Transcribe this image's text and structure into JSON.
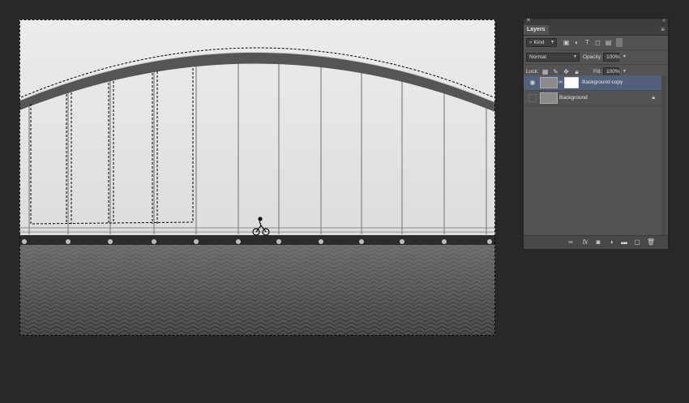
{
  "panel": {
    "tab_label": "Layers",
    "filter": {
      "kind_label": "Kind"
    },
    "blend_mode": "Normal",
    "opacity_label": "Opacity:",
    "opacity_value": "100%",
    "lock_label": "Lock:",
    "fill_label": "Fill:",
    "fill_value": "100%",
    "layers": [
      {
        "name": "Background copy",
        "visible": true,
        "selected": true,
        "has_mask": true
      },
      {
        "name": "Background",
        "visible": false,
        "selected": false,
        "locked": true
      }
    ]
  },
  "colors": {
    "app_bg": "#282828",
    "panel_bg": "#535353",
    "selection": "#52617a"
  },
  "icons": {
    "filter": [
      "pixel-filter-icon",
      "adjustment-filter-icon",
      "type-filter-icon",
      "shape-filter-icon",
      "smart-object-filter-icon",
      "filter-toggle-icon"
    ],
    "lock": [
      "lock-transparent-icon",
      "lock-image-icon",
      "lock-position-icon",
      "lock-all-icon"
    ],
    "footer": [
      "link-layers-icon",
      "fx-icon",
      "add-mask-icon",
      "adjustment-layer-icon",
      "new-group-icon",
      "new-layer-icon",
      "trash-icon"
    ]
  }
}
